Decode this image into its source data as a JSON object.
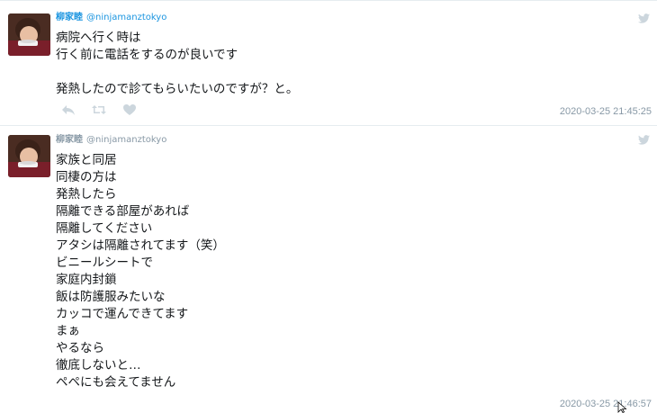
{
  "tweets": [
    {
      "display_name": "柳家睦",
      "handle": "@ninjamanztokyo",
      "lines": "病院へ行く時は\n行く前に電話をするのが良いです\n\n発熱したので診てもらいたいのですが？と。",
      "timestamp": "2020-03-25 21:45:25"
    },
    {
      "display_name": "柳家睦",
      "handle": "@ninjamanztokyo",
      "lines": "家族と同居\n同棲の方は\n発熱したら\n隔離できる部屋があれば\n隔離してください\nアタシは隔離されてます（笑）\nビニールシートで\n家庭内封鎖\n飯は防護服みたいな\nカッコで運んできてます\nまぁ\nやるなら\n徹底しないと…\nペペにも会えてません",
      "timestamp": "2020-03-25 21:46:57"
    }
  ],
  "icons": {
    "reply": "reply-icon",
    "retweet": "retweet-icon",
    "like": "heart-icon",
    "brand": "twitter-bird-icon"
  },
  "colors": {
    "link": "#1b95e0",
    "muted": "#8899a6",
    "icon": "#ccd6dd",
    "divider": "#e6ecf0"
  }
}
